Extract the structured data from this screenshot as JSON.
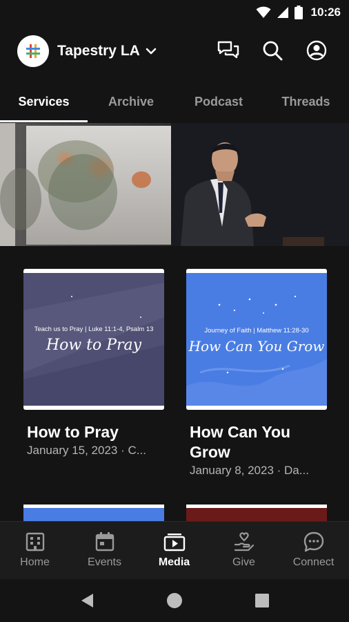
{
  "status_bar": {
    "time": "10:26"
  },
  "header": {
    "org_name": "Tapestry LA"
  },
  "tabs": [
    {
      "label": "Services",
      "active": true
    },
    {
      "label": "Archive",
      "active": false
    },
    {
      "label": "Podcast",
      "active": false
    },
    {
      "label": "Threads",
      "active": false
    }
  ],
  "cards": [
    {
      "title": "How to Pray",
      "date": "January 15, 2023 · C...",
      "thumb_subtitle": "Teach us to Pray  |  Luke 11:1-4, Psalm 13",
      "thumb_title": "How to Pray",
      "thumb_color": "#4f4f73"
    },
    {
      "title": "How Can You Grow",
      "date": "January 8, 2023 · Da...",
      "thumb_subtitle": "Journey of Faith  |  Matthew 11:28-30",
      "thumb_title": "How Can You Grow",
      "thumb_color": "#4a7de3"
    }
  ],
  "partial_cards": [
    {
      "color": "#4a7de3"
    },
    {
      "color": "#6b1a1a"
    }
  ],
  "bottom_nav": [
    {
      "label": "Home",
      "icon": "building-icon",
      "active": false
    },
    {
      "label": "Events",
      "icon": "calendar-icon",
      "active": false
    },
    {
      "label": "Media",
      "icon": "media-icon",
      "active": true
    },
    {
      "label": "Give",
      "icon": "give-heart-icon",
      "active": false
    },
    {
      "label": "Connect",
      "icon": "chat-bubble-icon",
      "active": false
    }
  ],
  "colors": {
    "background": "#141414",
    "nav_background": "#1c1c1c",
    "inactive_text": "#9a9a9a"
  }
}
